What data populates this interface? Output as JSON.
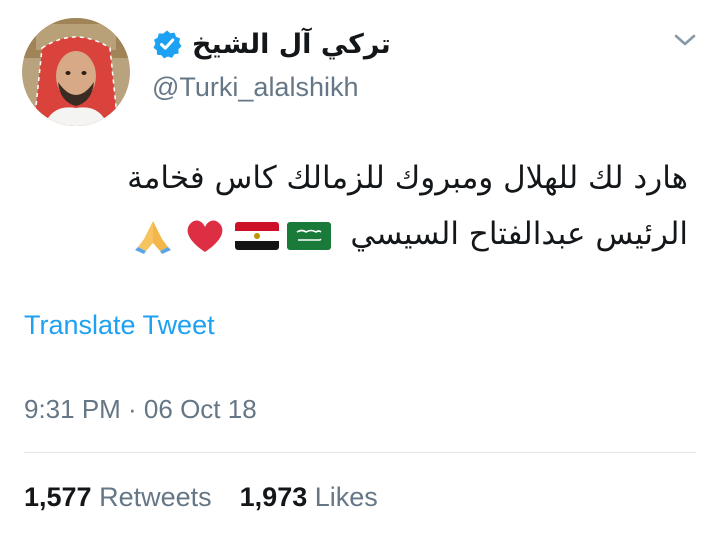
{
  "author": {
    "display_name": "تركي آل الشيخ",
    "handle": "@Turki_alalshikh",
    "verified": true
  },
  "tweet": {
    "text_line_1": "هارد لك للهلال ومبروك للزمالك كاس فخامة",
    "text_line_2": "الرئيس عبدالفتاح السيسي",
    "emojis": [
      "folded-hands-emoji",
      "red-heart-emoji",
      "egypt-flag-emoji",
      "saudi-flag-emoji"
    ],
    "translate_label": "Translate Tweet",
    "timestamp": "9:31 PM · 06 Oct 18"
  },
  "stats": {
    "retweets_count": "1,577",
    "retweets_label": "Retweets",
    "likes_count": "1,973",
    "likes_label": "Likes"
  },
  "colors": {
    "link": "#1da1f2",
    "secondary_text": "#657786",
    "primary_text": "#14171a",
    "divider": "#e1e8ed"
  }
}
